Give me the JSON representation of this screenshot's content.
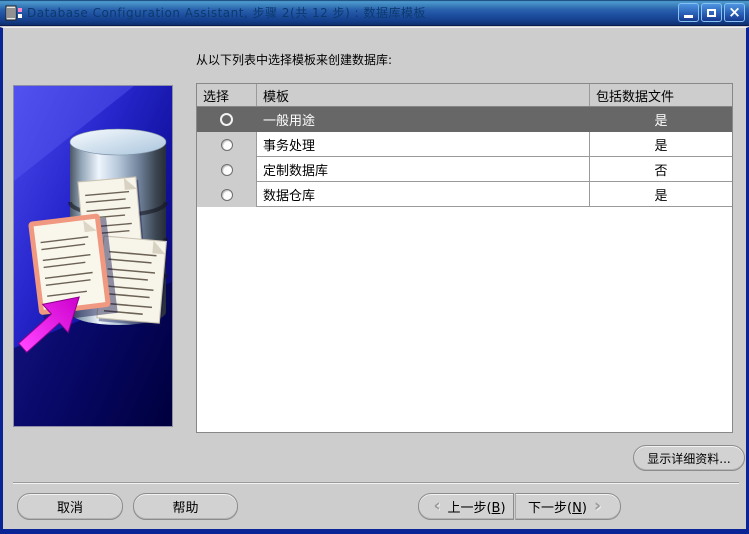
{
  "window": {
    "title": "Database Configuration Assistant, 步骤 2(共 12 步) : 数据库模板"
  },
  "icons": {
    "close": "×",
    "back_chevron": "‹",
    "next_chevron": "›"
  },
  "main": {
    "instruction": "从以下列表中选择模板来创建数据库:"
  },
  "table": {
    "columns": [
      "选择",
      "模板",
      "包括数据文件"
    ],
    "rows": [
      {
        "template": "一般用途",
        "includes_datafiles": "是",
        "selected": true
      },
      {
        "template": "事务处理",
        "includes_datafiles": "是",
        "selected": false
      },
      {
        "template": "定制数据库",
        "includes_datafiles": "否",
        "selected": false
      },
      {
        "template": "数据仓库",
        "includes_datafiles": "是",
        "selected": false
      }
    ]
  },
  "buttons": {
    "show_details": "显示详细资料...",
    "cancel": "取消",
    "help": "帮助",
    "back": {
      "pre": "上一步(",
      "mnemonic": "B",
      "post": ")"
    },
    "next": {
      "pre": "下一步(",
      "mnemonic": "N",
      "post": ")"
    }
  },
  "colors": {
    "selected_row_bg": "#676767",
    "titlebar_blue": "#1d4f9f",
    "window_border": "#0a2495",
    "art_magenta": "#ee22ee"
  }
}
